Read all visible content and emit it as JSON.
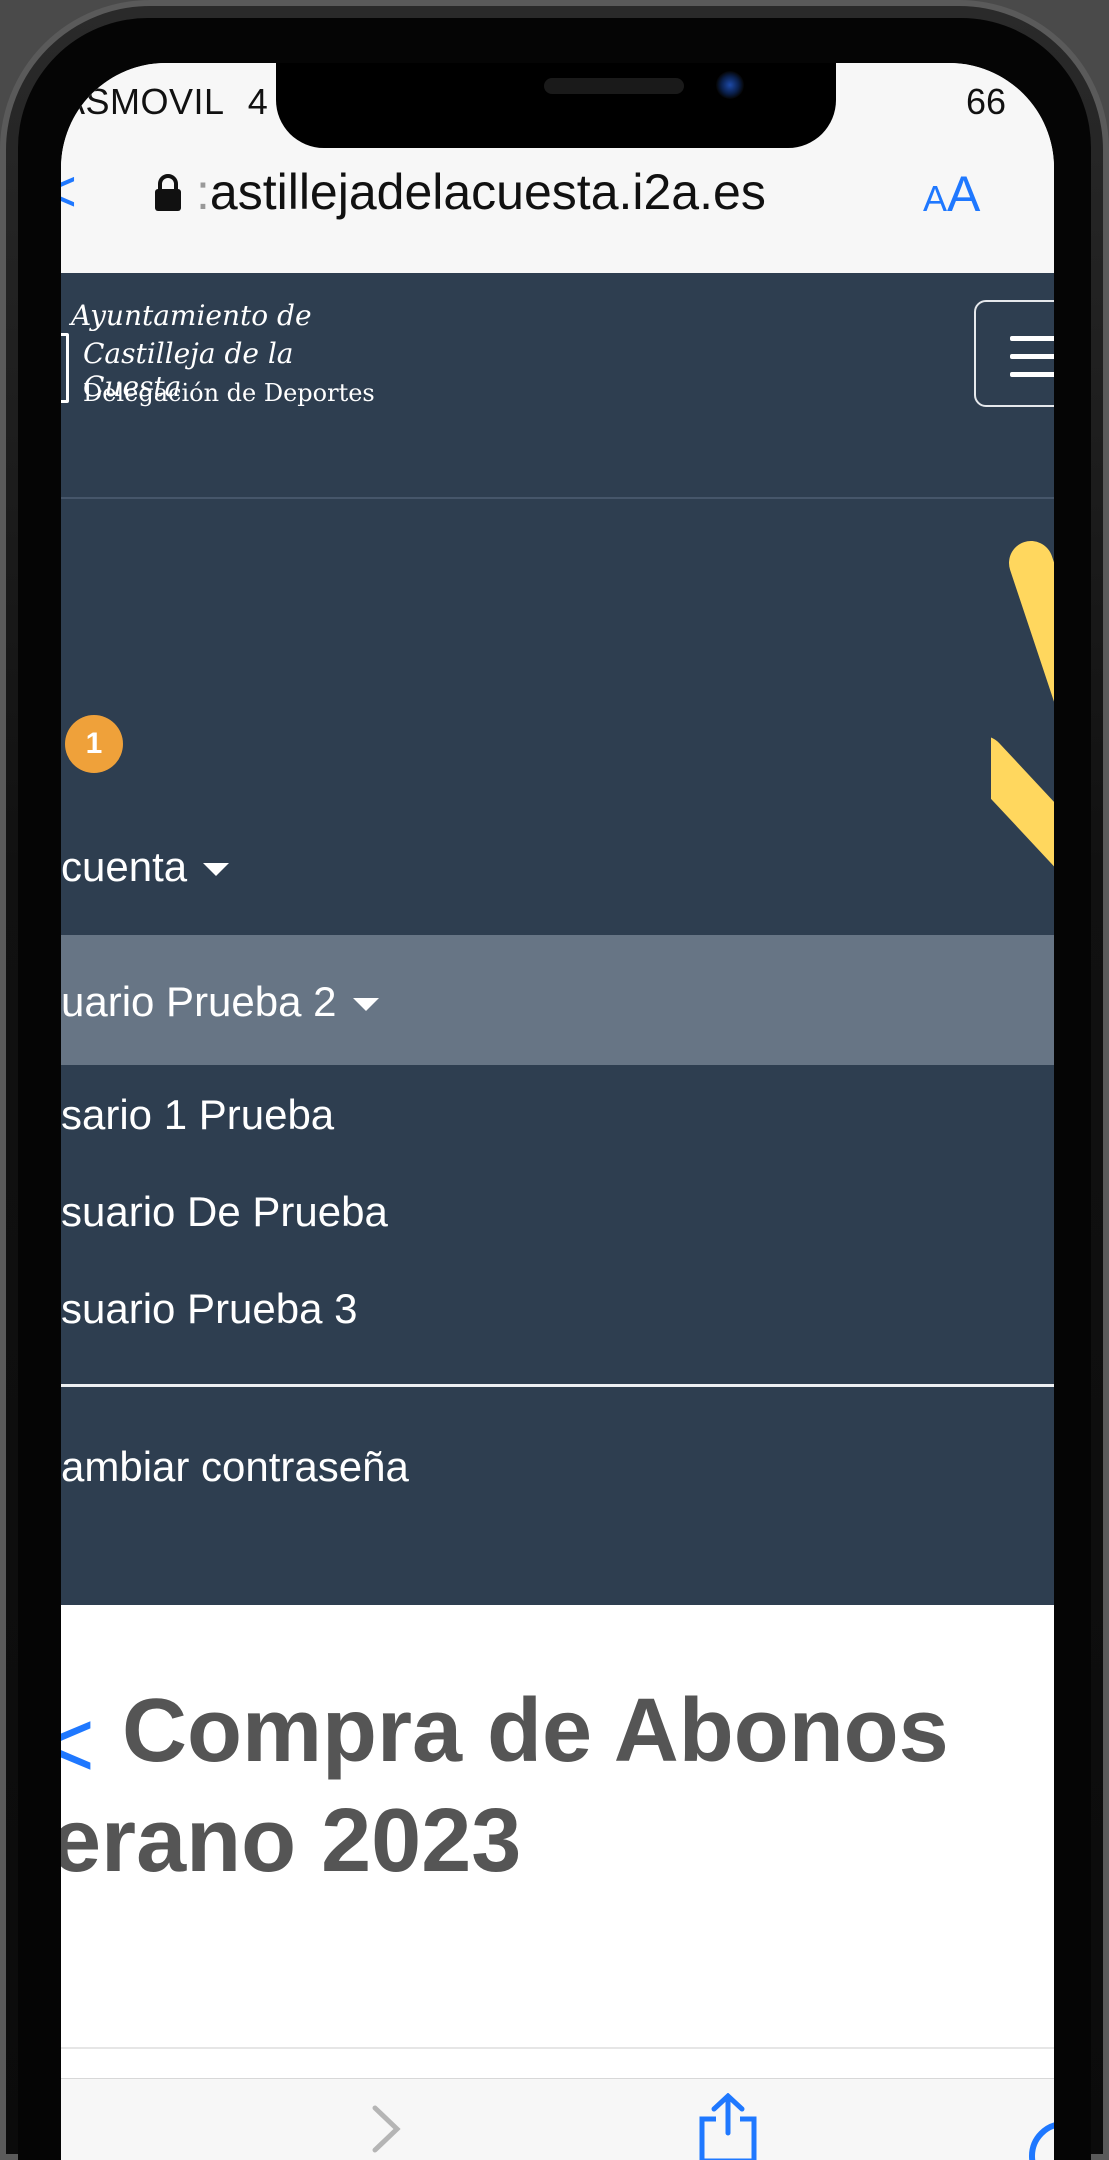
{
  "status_bar": {
    "carrier": "ASMOVIL",
    "carrier_tail": "4",
    "battery": "66"
  },
  "browser": {
    "back_glyph": "<",
    "url": "astillejadelacuesta.i2a.es",
    "url_prefix": ":",
    "text_size_button": "AA"
  },
  "site": {
    "logo": {
      "line1": "Ayuntamiento de",
      "line2": "Castilleja de la Cuesta",
      "line3": "Delegación de Deportes"
    },
    "notification_count": "1",
    "menu": {
      "account": "cuenta",
      "active_user": "uario Prueba 2",
      "users": [
        "sario 1 Prueba",
        "suario De Prueba",
        "suario Prueba 3"
      ],
      "change_password": "ambiar contraseña"
    }
  },
  "page": {
    "title_line1": "Compra de Abonos",
    "title_line2": "erano 2023"
  },
  "colors": {
    "nav_bg": "#2e3e50",
    "active_row": "#677585",
    "badge": "#efa13a",
    "ios_blue": "#1f78ff",
    "annotation_yellow": "#ffd75e"
  }
}
